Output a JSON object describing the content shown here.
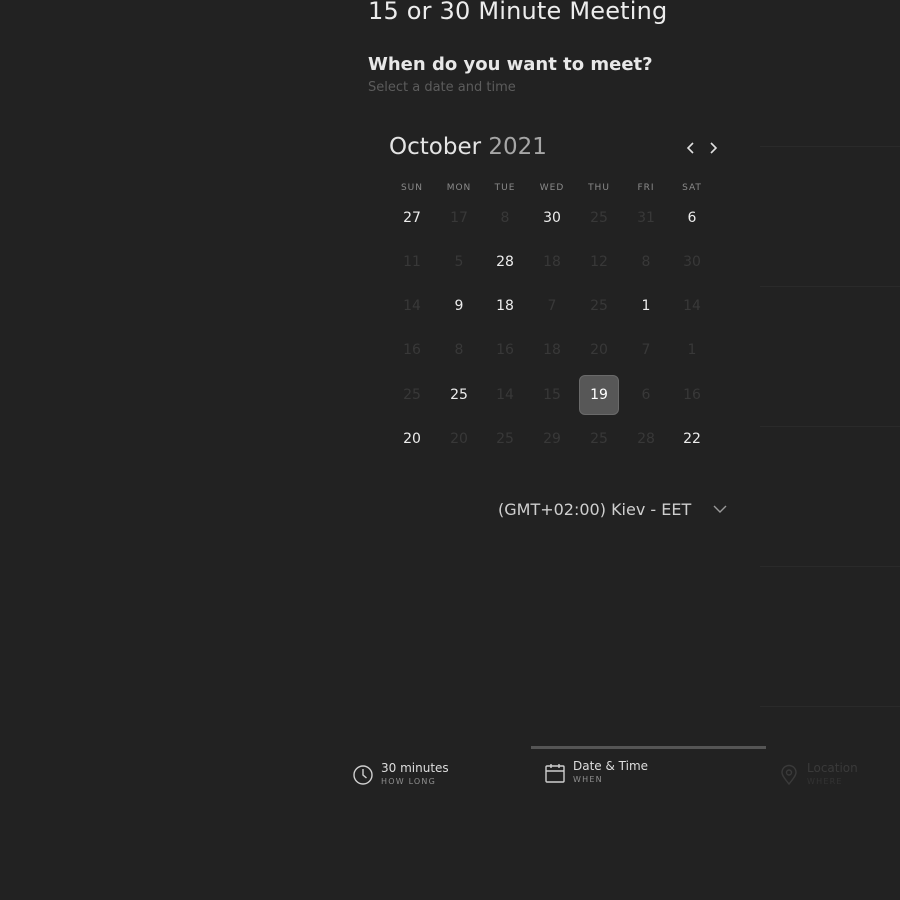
{
  "header": {
    "title": "15 or 30 Minute Meeting",
    "question": "When do you want to meet?",
    "subtitle": "Select a date and time"
  },
  "calendar": {
    "month": "October",
    "year": "2021",
    "weekdays": [
      "SUN",
      "MON",
      "TUE",
      "WED",
      "THU",
      "FRI",
      "SAT"
    ],
    "weeks": [
      [
        {
          "d": "27",
          "on": true
        },
        {
          "d": "17",
          "on": false
        },
        {
          "d": "8",
          "on": false
        },
        {
          "d": "30",
          "on": true
        },
        {
          "d": "25",
          "on": false
        },
        {
          "d": "31",
          "on": false
        },
        {
          "d": "6",
          "on": true
        }
      ],
      [
        {
          "d": "11",
          "on": false
        },
        {
          "d": "5",
          "on": false
        },
        {
          "d": "28",
          "on": true
        },
        {
          "d": "18",
          "on": false
        },
        {
          "d": "12",
          "on": false
        },
        {
          "d": "8",
          "on": false
        },
        {
          "d": "30",
          "on": false
        }
      ],
      [
        {
          "d": "14",
          "on": false
        },
        {
          "d": "9",
          "on": true
        },
        {
          "d": "18",
          "on": true
        },
        {
          "d": "7",
          "on": false
        },
        {
          "d": "25",
          "on": false
        },
        {
          "d": "1",
          "on": true
        },
        {
          "d": "14",
          "on": false
        }
      ],
      [
        {
          "d": "16",
          "on": false
        },
        {
          "d": "8",
          "on": false
        },
        {
          "d": "16",
          "on": false
        },
        {
          "d": "18",
          "on": false
        },
        {
          "d": "20",
          "on": false
        },
        {
          "d": "7",
          "on": false
        },
        {
          "d": "1",
          "on": false
        }
      ],
      [
        {
          "d": "25",
          "on": false
        },
        {
          "d": "25",
          "on": true
        },
        {
          "d": "14",
          "on": false
        },
        {
          "d": "15",
          "on": false
        },
        {
          "d": "19",
          "on": true,
          "selected": true
        },
        {
          "d": "6",
          "on": false
        },
        {
          "d": "16",
          "on": false
        }
      ],
      [
        {
          "d": "20",
          "on": true
        },
        {
          "d": "20",
          "on": false
        },
        {
          "d": "25",
          "on": false
        },
        {
          "d": "29",
          "on": false
        },
        {
          "d": "25",
          "on": false
        },
        {
          "d": "28",
          "on": false
        },
        {
          "d": "22",
          "on": true
        }
      ]
    ]
  },
  "timezone": {
    "value": "(GMT+02:00) Kiev - EET"
  },
  "steps": [
    {
      "title": "30 minutes",
      "sub": "HOW LONG",
      "icon": "clock-icon",
      "active": false,
      "dim": false
    },
    {
      "title": "Date & Time",
      "sub": "WHEN",
      "icon": "calendar-icon",
      "active": true,
      "dim": false
    },
    {
      "title": "Location",
      "sub": "WHERE",
      "icon": "location-pin-icon",
      "active": false,
      "dim": true
    }
  ],
  "colors": {
    "background": "#222222",
    "selected_day": "#575757",
    "active_step_bar": "#555555"
  }
}
